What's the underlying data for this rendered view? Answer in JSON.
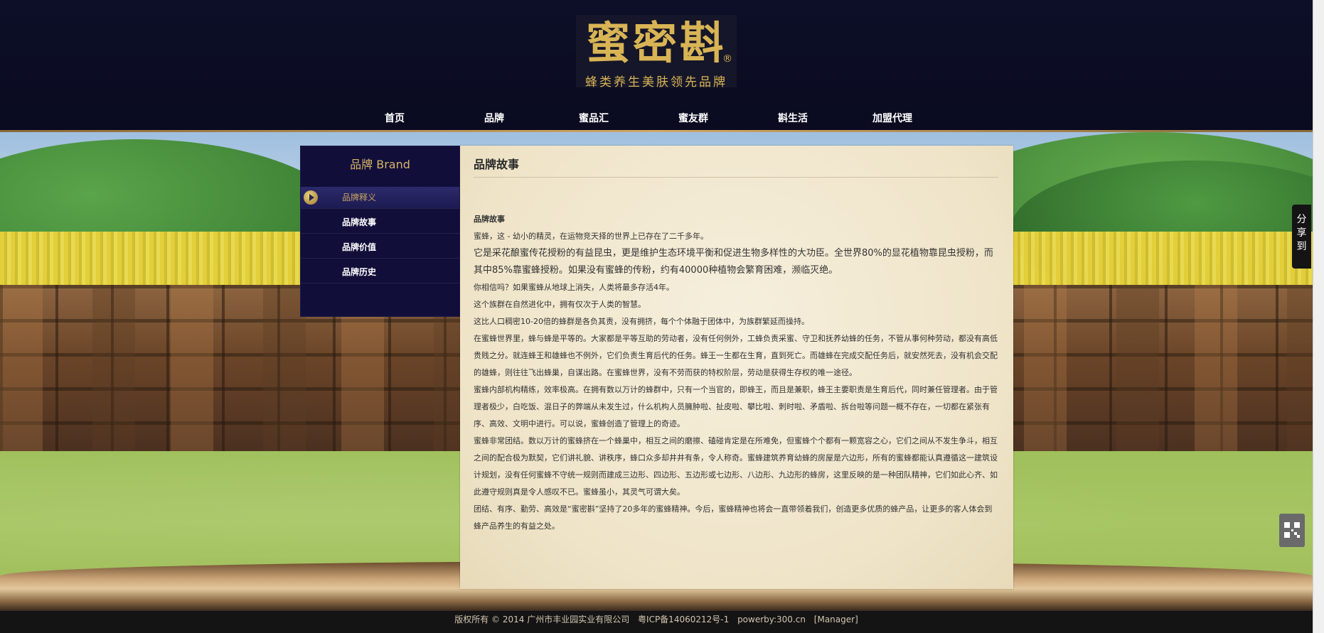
{
  "logo": {
    "mark": "蜜密斟",
    "registered": "®",
    "tagline": "蜂类养生美肤领先品牌"
  },
  "nav": {
    "items": [
      {
        "label": "首页"
      },
      {
        "label": "品牌"
      },
      {
        "label": "蜜品汇"
      },
      {
        "label": "蜜友群"
      },
      {
        "label": "斟生活"
      },
      {
        "label": "加盟代理"
      }
    ]
  },
  "sidebar": {
    "title": "品牌 Brand",
    "items": [
      {
        "label": "品牌释义",
        "active": true
      },
      {
        "label": "品牌故事",
        "active": false
      },
      {
        "label": "品牌价值",
        "active": false
      },
      {
        "label": "品牌历史",
        "active": false
      }
    ]
  },
  "content": {
    "title": "品牌故事",
    "paragraphs": [
      "品牌故事",
      "蜜蜂，这 - 幼小的精灵，在运物竞天择的世界上已存在了二千多年。",
      "它是采花酿蜜传花授粉的有益昆虫，更是维护生态环境平衡和促进生物多样性的大功臣。全世界80%的显花植物靠昆虫授粉，而其中85%靠蜜蜂授粉。如果没有蜜蜂的传粉，约有40000种植物会繁育困难，濒临灭绝。",
      "你相信吗？如果蜜蜂从地球上消失，人类将最多存活4年。",
      "这个族群在自然进化中，拥有仅次于人类的智慧。",
      "这比人口稠密10-20倍的蜂群是各负其责，没有拥挤，每个个体融于团体中，为族群繁延而操持。",
      "在蜜蜂世界里，蜂与蜂是平等的。大家都是平等互助的劳动者，没有任何例外，工蜂负责采蜜、守卫和抚养幼蜂的任务，不管从事何种劳动，都没有高低贵贱之分。就连蜂王和雄蜂也不例外，它们负责生育后代的任务。蜂王一生都在生育，直到死亡。而雄蜂在完成交配任务后，就安然死去，没有机会交配的雄蜂，则往往飞出蜂巢，自谋出路。在蜜蜂世界，没有不劳而获的特权阶层，劳动是获得生存权的唯一途径。",
      "蜜蜂内部机构精练，效率极高。在拥有数以万计的蜂群中，只有一个当官的，即蜂王，而且是兼职，蜂王主要职责是生育后代，同时兼任管理者。由于管理者极少，白吃饭、混日子的弊端从未发生过，什么机构人员臃肿啦、扯皮啦、攀比啦、刺时啦、矛盾啦、拆台啦等问题一概不存在，一切都在紧张有序、高效、文明中进行。可以说，蜜蜂创造了管理上的奇迹。",
      "蜜蜂非常团结。数以万计的蜜蜂挤在一个蜂巢中，相互之间的磨擦、磕碰肯定是在所难免，但蜜蜂个个都有一颗宽容之心，它们之间从不发生争斗，相互之间的配合极为默契，它们讲礼貌、讲秩序，蜂口众多却井井有条，令人称奇。蜜蜂建筑养育幼蜂的房屋是六边形，所有的蜜蜂都能认真遵循这一建筑设计规划，没有任何蜜蜂不守统一规则而建成三边形、四边形、五边形或七边形、八边形、九边形的蜂房，这里反映的是一种团队精神，它们如此心齐、如此遵守规则真是令人感叹不已。蜜蜂虽小，其灵气可谓大矣。",
      "团结、有序、勤劳、高效是“蜜密斟”坚持了20多年的蜜蜂精神。今后，蜜蜂精神也将会一直带领着我们，创造更多优质的蜂产品，让更多的客人体会到蜂产品养生的有益之处。"
    ]
  },
  "share": {
    "label": "分享到"
  },
  "qr": {
    "icon": "qr-code-icon"
  },
  "footer": {
    "copyright": "版权所有 © 2014 广州市丰业园实业有限公司",
    "icp": "粤ICP备14060212号-1",
    "powered": "powerby:300.cn",
    "manager": "[Manager]"
  }
}
